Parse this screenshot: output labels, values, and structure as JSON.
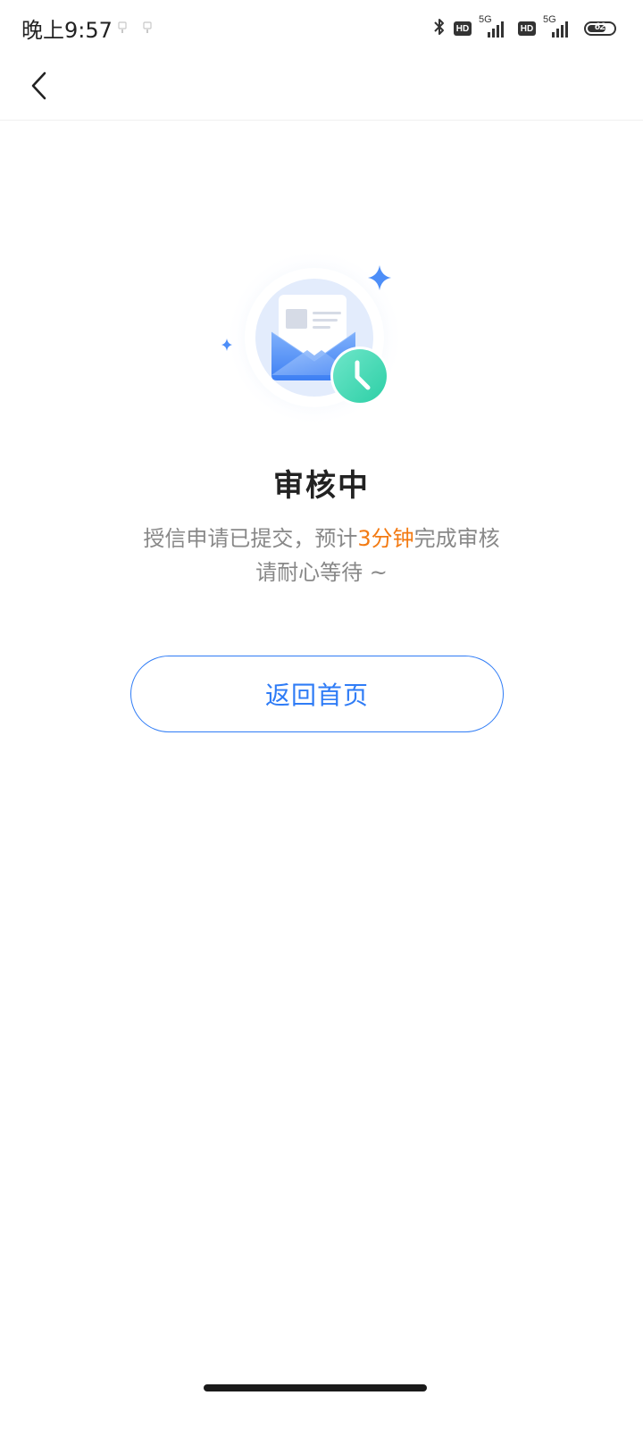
{
  "status_bar": {
    "time": "晚上9:57",
    "hd_label": "HD",
    "network_label": "5G",
    "battery_level": "62"
  },
  "nav": {
    "back_icon": "chevron-left-icon"
  },
  "illustration": {
    "icon": "envelope-with-clock-icon",
    "accent_color": "#4d8ef8",
    "clock_color": "#3ed6b4"
  },
  "result": {
    "title": "审核中",
    "desc_prefix": "授信申请已提交，预计",
    "desc_highlight": "3分钟",
    "desc_suffix": "完成审核",
    "desc_line2": "请耐心等待 ~",
    "highlight_color": "#f37a12"
  },
  "actions": {
    "home_label": "返回首页"
  }
}
